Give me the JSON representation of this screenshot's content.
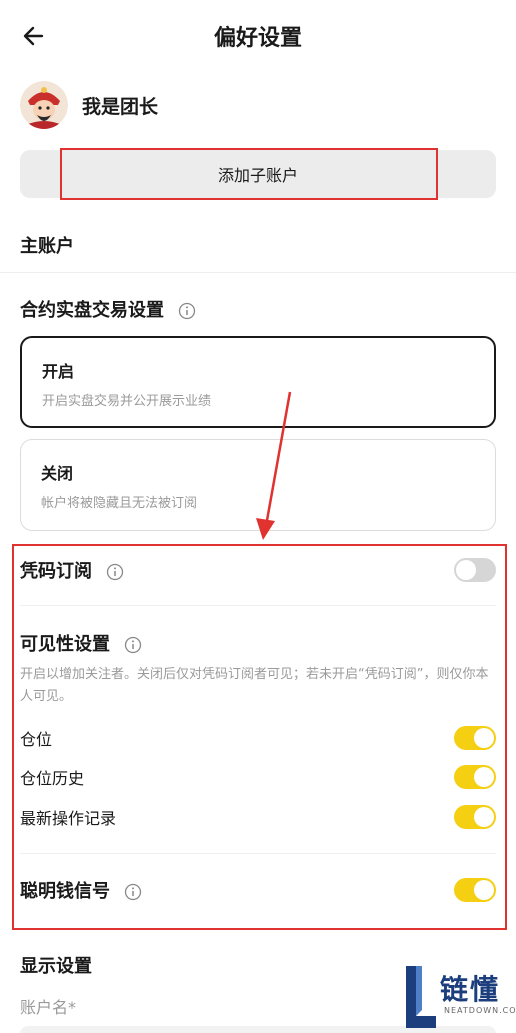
{
  "header": {
    "title": "偏好设置"
  },
  "profile": {
    "name": "我是团长"
  },
  "add_sub_account": {
    "label": "添加子账户"
  },
  "main_account": {
    "label": "主账户"
  },
  "contract": {
    "title": "合约实盘交易设置",
    "options": [
      {
        "title": "开启",
        "desc": "开启实盘交易并公开展示业绩",
        "selected": true
      },
      {
        "title": "关闭",
        "desc": "帐户将被隐藏且无法被订阅",
        "selected": false
      }
    ]
  },
  "code_subscription": {
    "label": "凭码订阅",
    "enabled": false
  },
  "visibility": {
    "title": "可见性设置",
    "desc": "开启以增加关注者。关闭后仅对凭码订阅者可见；若未开启“凭码订阅”，则仅你本人可见。",
    "items": [
      {
        "label": "仓位",
        "enabled": true
      },
      {
        "label": "仓位历史",
        "enabled": true
      },
      {
        "label": "最新操作记录",
        "enabled": true
      }
    ]
  },
  "smart_money": {
    "label": "聪明钱信号",
    "enabled": true
  },
  "display": {
    "title": "显示设置",
    "account_name_label": "账户名*"
  },
  "watermark": {
    "text": "链懂",
    "sub": "NEATDOWN.COM"
  },
  "colors": {
    "accent": "#f5cf12",
    "highlight": "#e0322f",
    "text": "#1a1a1a",
    "muted": "#9a9a9a"
  }
}
